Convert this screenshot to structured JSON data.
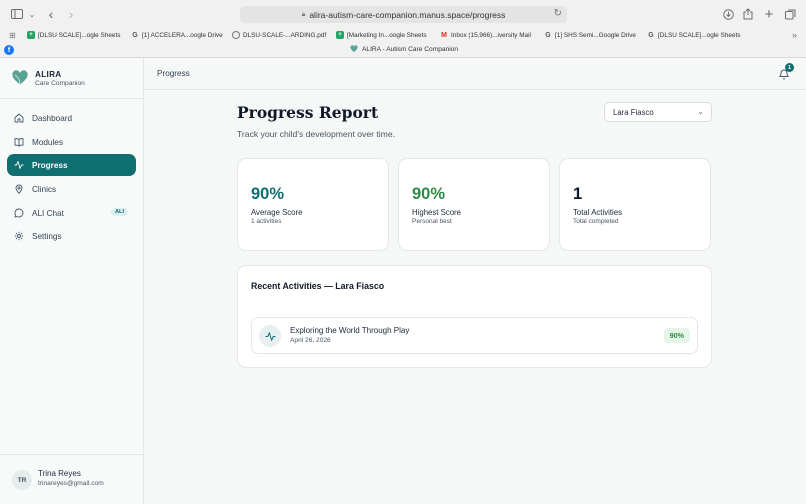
{
  "browser": {
    "url": "alira-autism-care-companion.manus.space/progress",
    "tab_title": "ALIRA - Autism Care Companion",
    "bookmarks": [
      {
        "label": "[DLSU SCALE]...ogle Sheets",
        "icon": "sheets-icon"
      },
      {
        "label": "[1] ACCELERA...oogle Drive",
        "icon": "google-icon"
      },
      {
        "label": "DLSU-SCALE-...ARDING.pdf",
        "icon": "compass-icon"
      },
      {
        "label": "[Marketing In...oogle Sheets",
        "icon": "sheets-icon"
      },
      {
        "label": "Inbox (15,966)...iversity Mail",
        "icon": "gmail-icon"
      },
      {
        "label": "[1] SHS Semi...Google Drive",
        "icon": "google-icon"
      },
      {
        "label": "[DLSU SCALE]...ogle Sheets",
        "icon": "google-icon"
      }
    ]
  },
  "sidebar": {
    "brand_name": "ALIRA",
    "brand_sub": "Care Companion",
    "items": [
      {
        "label": "Dashboard",
        "icon": "home-icon"
      },
      {
        "label": "Modules",
        "icon": "book-icon"
      },
      {
        "label": "Progress",
        "icon": "activity-icon",
        "active": true
      },
      {
        "label": "Clinics",
        "icon": "map-pin-icon"
      },
      {
        "label": "ALI Chat",
        "icon": "chat-icon",
        "badge": "ALI"
      },
      {
        "label": "Settings",
        "icon": "gear-icon"
      }
    ],
    "user": {
      "initials": "TR",
      "name": "Trina Reyes",
      "email": "trinareyes@gmail.com"
    }
  },
  "header": {
    "breadcrumb": "Progress",
    "notification_count": "1"
  },
  "main": {
    "title": "Progress Report",
    "subtitle": "Track your child's development over time.",
    "child_select": "Lara Fiasco",
    "stats": [
      {
        "value": "90%",
        "label": "Average Score",
        "hint": "1 activities",
        "color": "#0f6e70"
      },
      {
        "value": "90%",
        "label": "Highest Score",
        "hint": "Personal best",
        "color": "#2e8b45"
      },
      {
        "value": "1",
        "label": "Total Activities",
        "hint": "Total completed",
        "color": "#111827"
      }
    ],
    "recent_title": "Recent Activities — Lara Fiasco",
    "activities": [
      {
        "name": "Exploring the World Through Play",
        "date": "April 26, 2026",
        "score": "90%"
      }
    ]
  },
  "colors": {
    "accent": "#0f6e70",
    "success": "#2e8b45"
  }
}
